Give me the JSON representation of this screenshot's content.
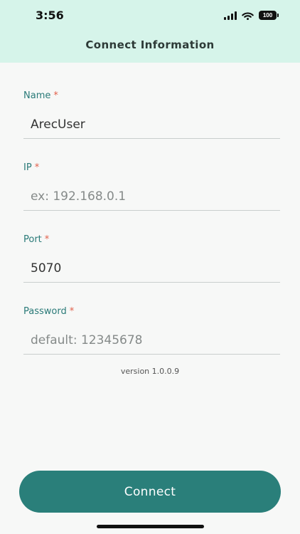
{
  "status_bar": {
    "time": "3:56",
    "battery_level": "100"
  },
  "header": {
    "title": "Connect Information"
  },
  "form": {
    "name": {
      "label": "Name",
      "required_mark": "*",
      "value": "ArecUser",
      "placeholder": ""
    },
    "ip": {
      "label": "IP",
      "required_mark": "*",
      "value": "",
      "placeholder": "ex: 192.168.0.1"
    },
    "port": {
      "label": "Port",
      "required_mark": "*",
      "value": "5070",
      "placeholder": ""
    },
    "password": {
      "label": "Password",
      "required_mark": "*",
      "value": "",
      "placeholder": "default: 12345678"
    }
  },
  "version_text": "version 1.0.0.9",
  "connect_label": "Connect",
  "colors": {
    "header_bg": "#d6f4ea",
    "accent": "#2a7f7a",
    "label": "#2a7a78",
    "required": "#e2604b"
  }
}
